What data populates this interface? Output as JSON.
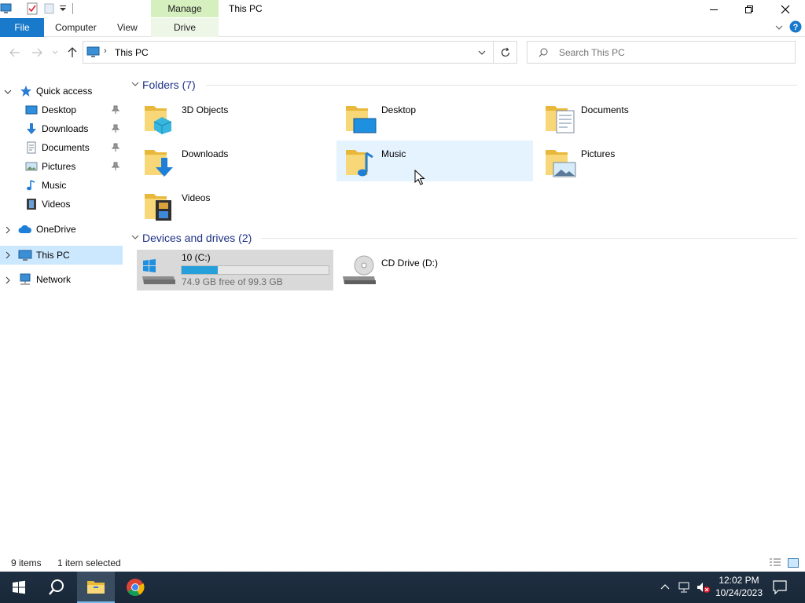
{
  "titlebar": {
    "manage_tab": "Manage",
    "title": "This PC"
  },
  "ribbon": {
    "file": "File",
    "computer": "Computer",
    "view": "View",
    "drive_tools": "Drive Tools"
  },
  "address": {
    "path": "This PC",
    "search_placeholder": "Search This PC"
  },
  "nav": {
    "quick_access": "Quick access",
    "quick_items": [
      {
        "label": "Desktop",
        "pinned": true
      },
      {
        "label": "Downloads",
        "pinned": true
      },
      {
        "label": "Documents",
        "pinned": true
      },
      {
        "label": "Pictures",
        "pinned": true
      },
      {
        "label": "Music",
        "pinned": false
      },
      {
        "label": "Videos",
        "pinned": false
      }
    ],
    "onedrive": "OneDrive",
    "this_pc": "This PC",
    "network": "Network"
  },
  "content": {
    "folders_header": "Folders (7)",
    "folders": [
      {
        "label": "3D Objects",
        "icon": "3d-objects-folder-icon"
      },
      {
        "label": "Desktop",
        "icon": "desktop-folder-icon"
      },
      {
        "label": "Documents",
        "icon": "documents-folder-icon"
      },
      {
        "label": "Downloads",
        "icon": "downloads-folder-icon"
      },
      {
        "label": "Music",
        "icon": "music-folder-icon"
      },
      {
        "label": "Pictures",
        "icon": "pictures-folder-icon"
      },
      {
        "label": "Videos",
        "icon": "videos-folder-icon"
      }
    ],
    "drives_header": "Devices and drives (2)",
    "drives": [
      {
        "label": "10 (C:)",
        "free_text": "74.9 GB free of 99.3 GB",
        "used_fraction": 0.246
      },
      {
        "label": "CD Drive (D:)"
      }
    ]
  },
  "status": {
    "items": "9 items",
    "selected": "1 item selected"
  },
  "taskbar": {
    "time": "12:02 PM",
    "date": "10/24/2023"
  },
  "colors": {
    "accent": "#1979ca",
    "selection": "#cce8ff",
    "hover": "#e5f3ff",
    "group_header": "#1e3287",
    "drive_fill": "#26a0da",
    "manage_tab": "#d6efbf"
  }
}
